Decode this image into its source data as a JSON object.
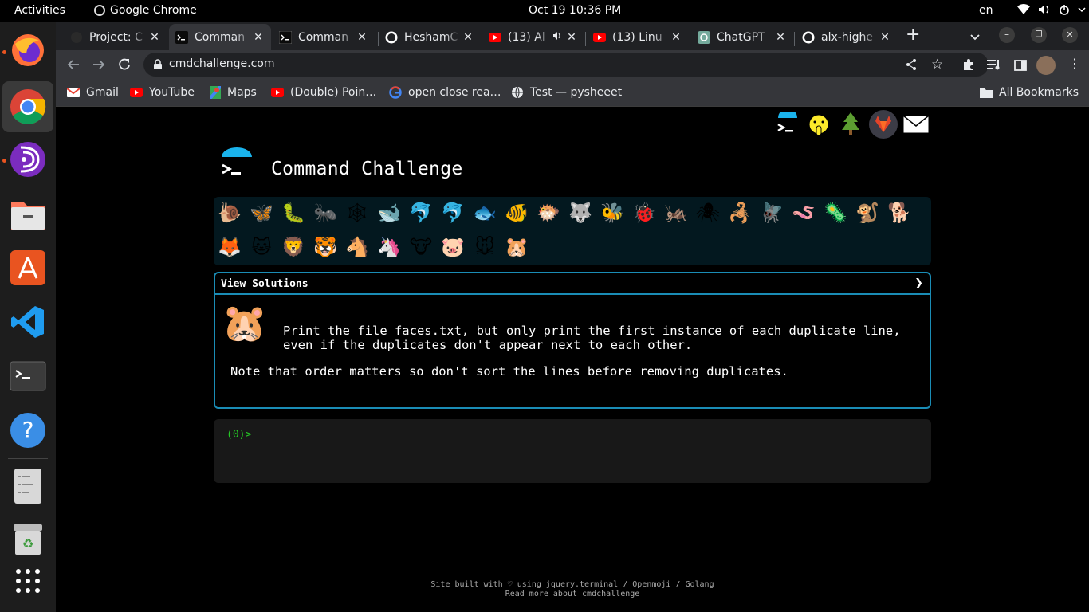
{
  "topbar": {
    "activities": "Activities",
    "app_name": "Google Chrome",
    "clock": "Oct 19  10:36 PM",
    "lang": "en"
  },
  "dock": {
    "items": [
      {
        "name": "firefox-icon"
      },
      {
        "name": "chrome-icon"
      },
      {
        "name": "podcast-icon"
      },
      {
        "name": "files-icon"
      },
      {
        "name": "app-center-icon"
      },
      {
        "name": "vscode-icon"
      },
      {
        "name": "terminal-icon"
      },
      {
        "name": "help-icon"
      },
      {
        "name": "text-editor-icon"
      },
      {
        "name": "trash-icon"
      },
      {
        "name": "app-grid-icon"
      }
    ]
  },
  "tabs": [
    {
      "title": "Project: C",
      "icon": "github-icon"
    },
    {
      "title": "Comman",
      "icon": "terminal-icon"
    },
    {
      "title": "Comman",
      "icon": "terminal-icon"
    },
    {
      "title": "HeshamC",
      "icon": "github-icon"
    },
    {
      "title": "(13) Al",
      "icon": "youtube-icon"
    },
    {
      "title": "(13) Linu",
      "icon": "youtube-icon"
    },
    {
      "title": "ChatGPT",
      "icon": "chatgpt-icon"
    },
    {
      "title": "alx-highe",
      "icon": "github-icon"
    }
  ],
  "omnibox": {
    "url": "cmdchallenge.com"
  },
  "bookmarks": [
    {
      "label": "Gmail",
      "icon": "gmail-icon"
    },
    {
      "label": "YouTube",
      "icon": "youtube-icon"
    },
    {
      "label": "Maps",
      "icon": "maps-icon"
    },
    {
      "label": "(Double) Poin…",
      "icon": "youtube-icon"
    },
    {
      "label": "open close rea…",
      "icon": "google-icon"
    },
    {
      "label": "Test — pysheeet",
      "icon": "globe-icon"
    }
  ],
  "all_bookmarks": "All Bookmarks",
  "page": {
    "title": "Command Challenge",
    "view_solutions": "View Solutions",
    "chevron": "❯",
    "challenge_line1": "Print the file faces.txt, but only print the first instance of each duplicate line,",
    "challenge_line2": "even if the duplicates don't appear next to each other.",
    "note": "Note that order matters so don't sort the lines before removing duplicates.",
    "prompt": "(0)>",
    "footer_line1": "Site built with ♡ using jquery.terminal / Openmoji / Golang",
    "footer_line2": "Read more about cmdchallenge"
  },
  "header_icons": [
    "terminal-logo-icon",
    "shushing-face-icon",
    "tree-icon",
    "gitlab-icon",
    "envelope-icon"
  ],
  "emoji_row1": [
    "🐌",
    "🦋",
    "🐛",
    "🐜",
    "🕸",
    "🐋",
    "🐬",
    "🐬",
    "🐟",
    "🐠",
    "🐡",
    "🐺",
    "🐝",
    "🐞",
    "🦗",
    "🕷",
    "🦂",
    "🪰",
    "🪱",
    "🦠",
    "🐒",
    "🐕"
  ],
  "emoji_row2": [
    "🦊",
    "🐱",
    "🦁",
    "🐯",
    "🐴",
    "🦄",
    "🐮",
    "🐷",
    "🐭",
    "🐹"
  ],
  "colors": {
    "accent": "#1a8cb5",
    "prompt": "#25c925",
    "terminal_bg": "#181818",
    "strip_bg": "#03181f"
  }
}
